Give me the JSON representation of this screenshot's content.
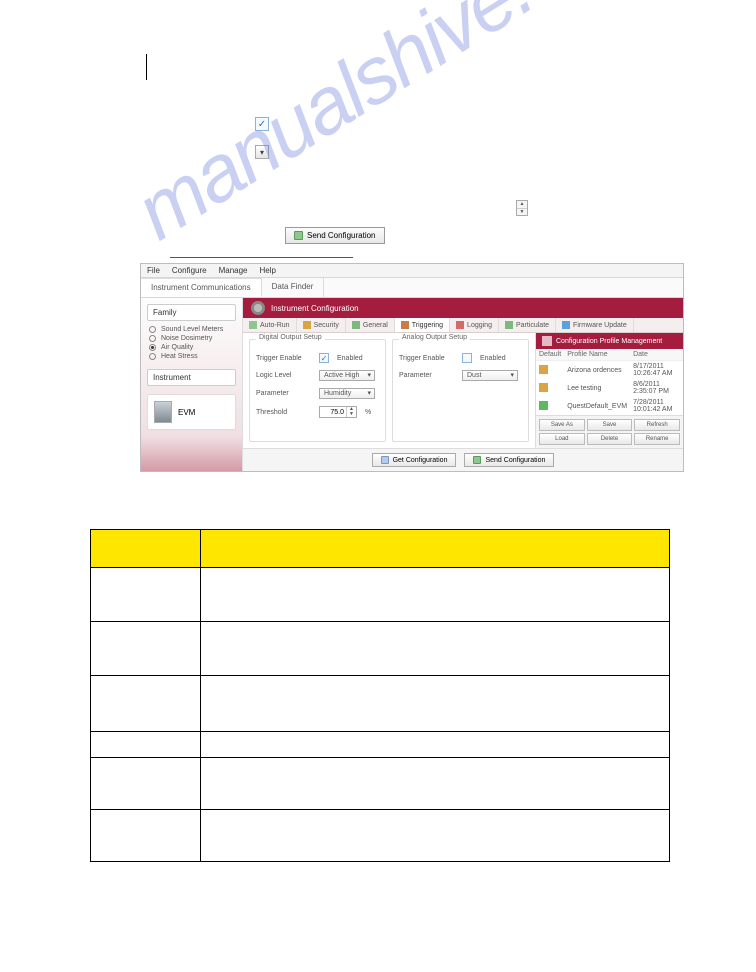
{
  "menubar": {
    "file": "File",
    "configure": "Configure",
    "manage": "Manage",
    "help": "Help"
  },
  "top_tabs": {
    "instrument": "Instrument Communications",
    "data_finder": "Data Finder"
  },
  "left": {
    "family_title": "Family",
    "radios": {
      "slm": "Sound Level Meters",
      "noise": "Noise Dosimetry",
      "air": "Air Quality",
      "heat": "Heat Stress"
    },
    "instrument_title": "Instrument",
    "evm": "EVM"
  },
  "titlebar": "Instrument Configuration",
  "subtabs": {
    "autorun": "Auto-Run",
    "security": "Security",
    "general": "General",
    "triggering": "Triggering",
    "logging": "Logging",
    "particulate": "Particulate",
    "firmware": "Firmware Update"
  },
  "digital": {
    "title": "Digital Output Setup",
    "trigger_enable_lbl": "Trigger Enable",
    "enabled_lbl": "Enabled",
    "logic_lbl": "Logic Level",
    "logic_val": "Active High",
    "param_lbl": "Parameter",
    "param_val": "Humidity",
    "threshold_lbl": "Threshold",
    "threshold_val": "75.0",
    "threshold_unit": "%"
  },
  "analog": {
    "title": "Analog Output Setup",
    "trigger_enable_lbl": "Trigger Enable",
    "enabled_lbl": "Enabled",
    "param_lbl": "Parameter",
    "param_val": "Dust"
  },
  "right": {
    "title": "Configuration Profile Management",
    "cols": {
      "def": "Default",
      "name": "Profile Name",
      "date": "Date"
    },
    "rows": [
      {
        "icon": "lock",
        "name": "Arizona ordences",
        "date": "8/17/2011 10:26:47 AM"
      },
      {
        "icon": "lock",
        "name": "Lee testing",
        "date": "8/6/2011 2:35:07 PM"
      },
      {
        "icon": "arrow",
        "name": "QuestDefault_EVM",
        "date": "7/28/2011 10:01:42 AM"
      }
    ],
    "buttons": {
      "saveas": "Save As",
      "save": "Save",
      "refresh": "Refresh",
      "load": "Load",
      "delete": "Delete",
      "rename": "Rename"
    }
  },
  "bottom": {
    "get": "Get Configuration",
    "send": "Send Configuration"
  },
  "sample_send": "Send Configuration",
  "watermark": "manualshive.com"
}
